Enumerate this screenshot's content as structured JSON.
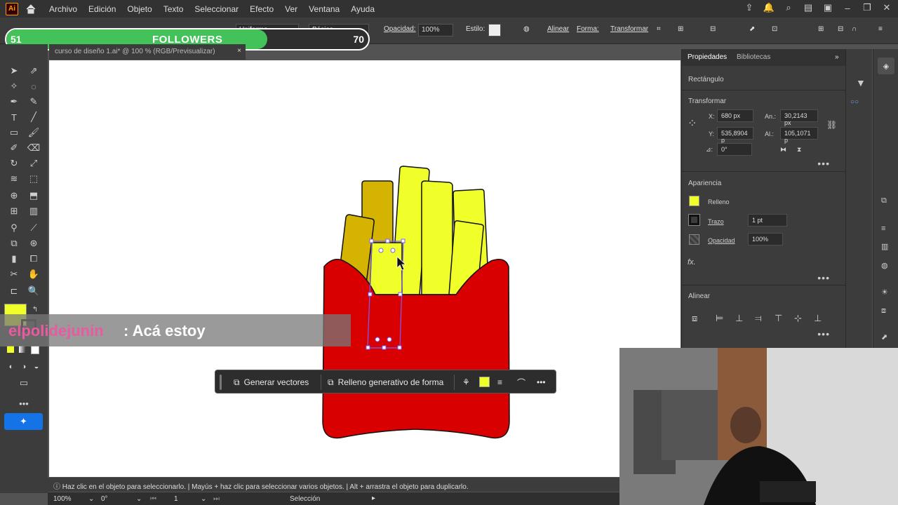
{
  "menubar": {
    "logo": "Ai",
    "items": [
      "Archivo",
      "Edición",
      "Objeto",
      "Texto",
      "Seleccionar",
      "Efecto",
      "Ver",
      "Ventana",
      "Ayuda"
    ]
  },
  "controlbar": {
    "stroke_profile": "Uniforme",
    "brush": "Básico",
    "opacity_label": "Opacidad:",
    "opacity_value": "100%",
    "style_label": "Estilo:",
    "align_label": "Alinear",
    "shape_label": "Forma:",
    "transform_label": "Transformar"
  },
  "followers": {
    "start": "51",
    "label": "FOLLOWERS",
    "end": "70",
    "progress": 0.72,
    "fill_color": "#44c25a"
  },
  "document": {
    "tab_title": "curso de diseño 1.ai* @ 100 % (RGB/Previsualizar)",
    "close": "×"
  },
  "chat": {
    "user": "elpolidejunin",
    "message": ": Acá estoy"
  },
  "context_bar": {
    "generate_vectors": "Generar vectores",
    "generative_fill": "Relleno generativo de forma",
    "more": "•••"
  },
  "status": {
    "hint": "Haz clic en el objeto para seleccionarlo. | Mayús + haz clic para seleccionar varios objetos. | Alt + arrastra el objeto para duplicarlo.",
    "zoom": "100%",
    "rotation": "0°",
    "artboard": "1",
    "tool": "Selección"
  },
  "panel": {
    "tab_properties": "Propiedades",
    "tab_libraries": "Bibliotecas",
    "object_type": "Rectángulo",
    "transform_title": "Transformar",
    "x_label": "X:",
    "x_value": "680 px",
    "y_label": "Y:",
    "y_value": "535,8904 p",
    "w_label": "An.:",
    "w_value": "30,2143 px",
    "h_label": "Al.:",
    "h_value": "105,1071 p",
    "angle_label": "⊿:",
    "angle_value": "0°",
    "appearance_title": "Apariencia",
    "fill_label": "Relleno",
    "fill_color": "#f0ff2a",
    "stroke_label": "Trazo",
    "stroke_value": "1 pt",
    "opacity_label": "Opacidad",
    "opacity_value": "100%",
    "fx_label": "fx.",
    "align_title": "Alinear"
  },
  "colors": {
    "fries_light": "#f0ff2a",
    "fries_dark": "#d4b400",
    "box_red": "#d80000",
    "selection": "#7b5cff"
  }
}
